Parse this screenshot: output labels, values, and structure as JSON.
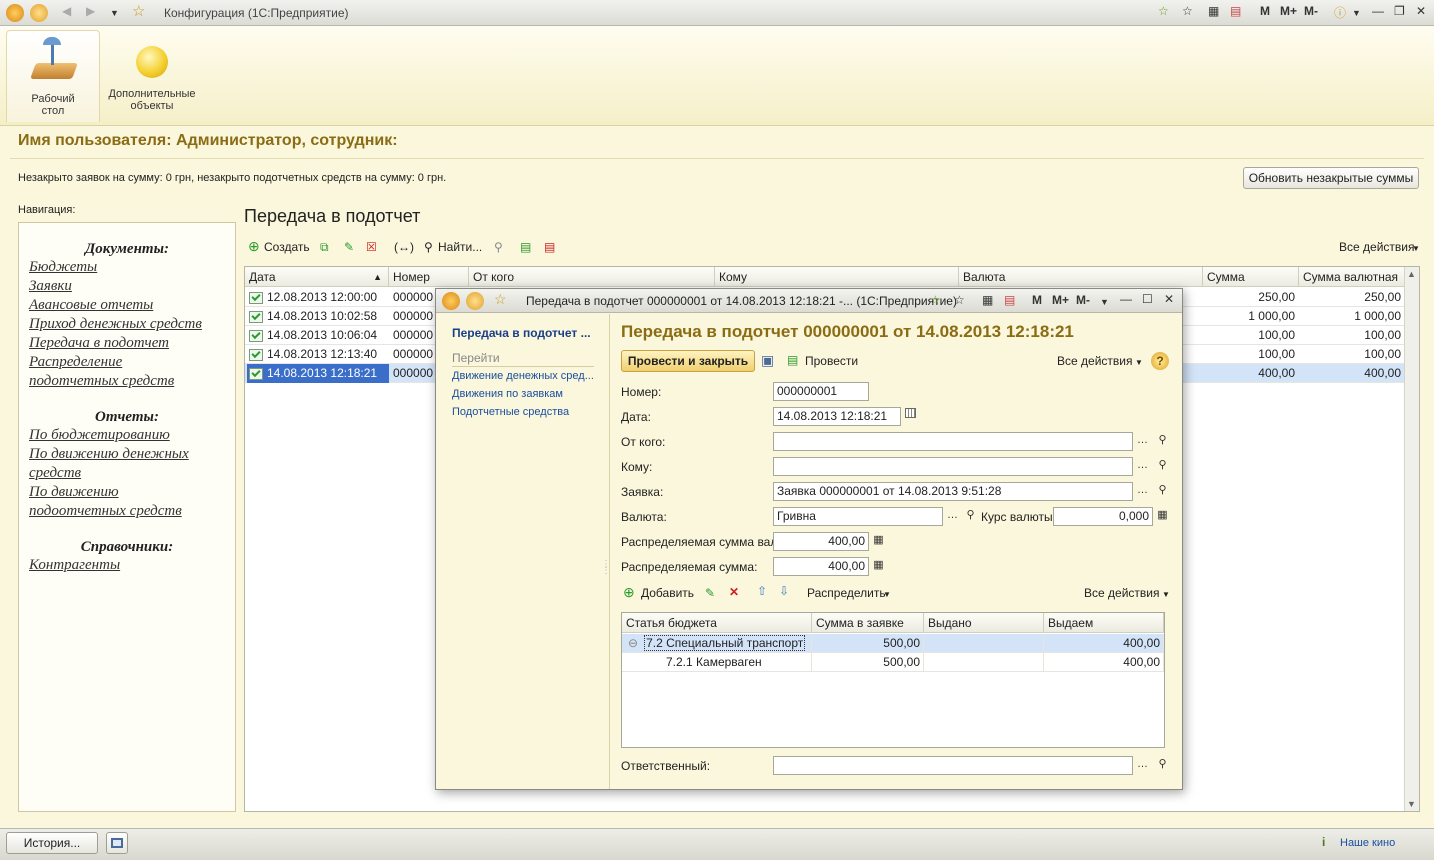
{
  "window": {
    "title": "Конфигурация  (1С:Предприятие)"
  },
  "sections": [
    {
      "label1": "Рабочий",
      "label2": "стол"
    },
    {
      "label1": "Дополнительные",
      "label2": "объекты"
    }
  ],
  "header": {
    "user_title": "Имя пользователя: Администратор, сотрудник:",
    "summary": "Незакрыто заявок на сумму: 0 грн, незакрыто подотчетных средств на сумму: 0 грн.",
    "refresh_button": "Обновить незакрытые суммы"
  },
  "navigation": {
    "label": "Навигация:",
    "groups": [
      {
        "title": "Документы:",
        "items": [
          "Бюджеты",
          "Заявки",
          "Авансовые отчеты",
          "Приход денежных средств",
          "Передача в подотчет",
          "Распределение",
          "подотчетных средств"
        ]
      },
      {
        "title": "Отчеты:",
        "items": [
          "По бюджетированию",
          "По движению денежных",
          "средств",
          "По движению",
          "подоотчетных средств"
        ]
      },
      {
        "title": "Справочники:",
        "items": [
          "Контрагенты"
        ]
      }
    ]
  },
  "list": {
    "title": "Передача в подотчет",
    "toolbar": {
      "create": "Создать",
      "find": "Найти...",
      "all_actions": "Все действия"
    },
    "columns": [
      "Дата",
      "Номер",
      "От кого",
      "Кому",
      "Валюта",
      "Сумма",
      "Сумма валютная"
    ],
    "rows": [
      {
        "date": "12.08.2013 12:00:00",
        "number": "000000",
        "sum": "250,00",
        "sum_cur": "250,00"
      },
      {
        "date": "14.08.2013 10:02:58",
        "number": "000000",
        "sum": "1 000,00",
        "sum_cur": "1 000,00"
      },
      {
        "date": "14.08.2013 10:06:04",
        "number": "000000",
        "sum": "100,00",
        "sum_cur": "100,00"
      },
      {
        "date": "14.08.2013 12:13:40",
        "number": "000000",
        "sum": "100,00",
        "sum_cur": "100,00"
      },
      {
        "date": "14.08.2013 12:18:21",
        "number": "000000",
        "sum": "400,00",
        "sum_cur": "400,00"
      }
    ],
    "selected_row": 4
  },
  "status": {
    "history_button": "История...",
    "kino": "Наше кино"
  },
  "modal": {
    "window_title": "Передача в подотчет 000000001 от 14.08.2013 12:18:21 -...  (1С:Предприятие)",
    "nav": {
      "current": "Передача в подотчет ...",
      "goto": "Перейти",
      "links": [
        "Движение денежных сред...",
        "Движения по заявкам",
        "Подотчетные средства"
      ]
    },
    "heading": "Передача в подотчет 000000001 от 14.08.2013 12:18:21",
    "toolbar": {
      "post_close": "Провести и закрыть",
      "post": "Провести",
      "all_actions": "Все действия"
    },
    "fields": {
      "number_label": "Номер:",
      "number": "000000001",
      "date_label": "Дата:",
      "date": "14.08.2013 12:18:21",
      "from_label": "От кого:",
      "from": "",
      "to_label": "Кому:",
      "to": "",
      "request_label": "Заявка:",
      "request": "Заявка 000000001 от 14.08.2013 9:51:28",
      "currency_label": "Валюта:",
      "currency": "Гривна",
      "rate_label": "Курс валюты:",
      "rate": "0,000",
      "dist_sum_cur_label": "Распределяемая сумма вал.:",
      "dist_sum_cur": "400,00",
      "dist_sum_label": "Распределяемая сумма:",
      "dist_sum": "400,00",
      "responsible_label": "Ответственный:",
      "responsible": ""
    },
    "table_toolbar": {
      "add": "Добавить",
      "distribute": "Распределить",
      "all_actions": "Все действия"
    },
    "table": {
      "columns": [
        "Статья бюджета",
        "Сумма в заявке",
        "Выдано",
        "Выдаем"
      ],
      "rows": [
        {
          "article": "7.2 Специальный транспорт",
          "in_request": "500,00",
          "issued": "",
          "issuing": "400,00"
        },
        {
          "article": "7.2.1 Камерваген",
          "in_request": "500,00",
          "issued": "",
          "issuing": "400,00"
        }
      ]
    }
  }
}
